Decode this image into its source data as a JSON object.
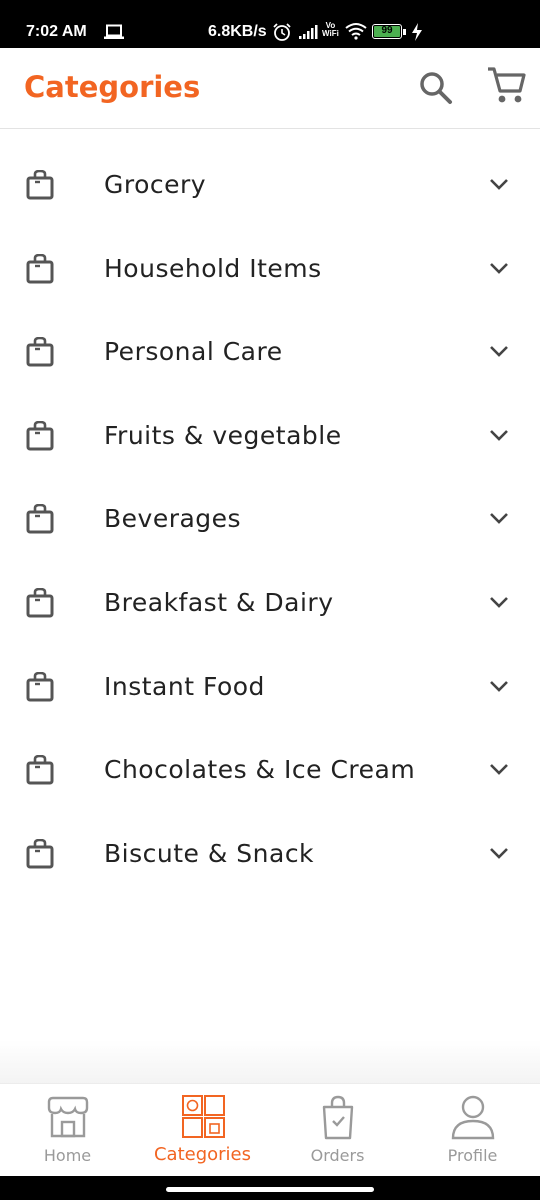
{
  "status_bar": {
    "time": "7:02 AM",
    "net_speed": "6.8KB/s",
    "vowifi_top": "Vo",
    "vowifi_bottom": "WiFi",
    "battery": "99"
  },
  "app_bar": {
    "title": "Categories",
    "accent_color": "#f26522"
  },
  "categories": [
    {
      "label": "Grocery"
    },
    {
      "label": "Household Items"
    },
    {
      "label": "Personal Care"
    },
    {
      "label": "Fruits & vegetable"
    },
    {
      "label": "Beverages"
    },
    {
      "label": "Breakfast & Dairy"
    },
    {
      "label": "Instant Food"
    },
    {
      "label": "Chocolates & Ice Cream"
    },
    {
      "label": "Biscute & Snack"
    }
  ],
  "bottom_nav": [
    {
      "label": "Home",
      "icon": "store-icon",
      "active": false
    },
    {
      "label": "Categories",
      "icon": "categories-icon",
      "active": true
    },
    {
      "label": "Orders",
      "icon": "shopping-bag-icon",
      "active": false
    },
    {
      "label": "Profile",
      "icon": "person-icon",
      "active": false
    }
  ]
}
